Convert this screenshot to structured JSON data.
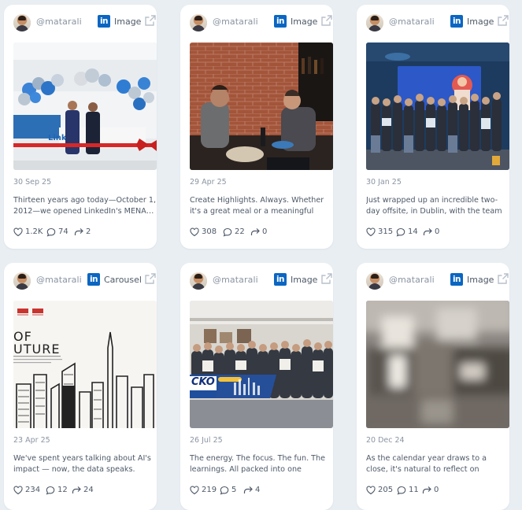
{
  "colors": {
    "background": "#e9eef3",
    "card": "#ffffff",
    "linkedin": "#0a66c2"
  },
  "posts": [
    {
      "handle": "@matarali",
      "network_icon": "linkedin-icon",
      "type": "Image",
      "date": "30 Sep 25",
      "caption": "Thirteen years ago today—October 1, 2012—we opened LinkedIn's MENA…",
      "likes": "1.2K",
      "comments": "74",
      "shares": "2"
    },
    {
      "handle": "@matarali",
      "network_icon": "linkedin-icon",
      "type": "Image",
      "date": "29 Apr 25",
      "caption": "Create Highlights. Always. Whether it's a great meal or a meaningful meetin…",
      "likes": "308",
      "comments": "22",
      "shares": "0"
    },
    {
      "handle": "@matarali",
      "network_icon": "linkedin-icon",
      "type": "Image",
      "date": "30 Jan 25",
      "caption": "Just wrapped up an incredible two-day offsite, in Dublin, with the team—…",
      "likes": "315",
      "comments": "14",
      "shares": "0"
    },
    {
      "handle": "@matarali",
      "network_icon": "linkedin-icon",
      "type": "Carousel",
      "date": "23 Apr 25",
      "caption": "We've spent years talking about AI's impact — now, the data speaks. The…",
      "likes": "234",
      "comments": "12",
      "shares": "24",
      "media_text": {
        "line1": "OF",
        "line2": "UTURE"
      }
    },
    {
      "handle": "@matarali",
      "network_icon": "linkedin-icon",
      "type": "Image",
      "date": "26 Jul 25",
      "caption": "The energy. The focus. The fun. The learnings. All packed into one week.…",
      "likes": "219",
      "comments": "5",
      "shares": "4",
      "media_text": {
        "banner": "CKO"
      }
    },
    {
      "handle": "@matarali",
      "network_icon": "linkedin-icon",
      "type": "Image",
      "date": "20 Dec 24",
      "caption": "As the calendar year draws to a close, it's natural to reflect on milestones,…",
      "likes": "205",
      "comments": "11",
      "shares": "0"
    }
  ]
}
